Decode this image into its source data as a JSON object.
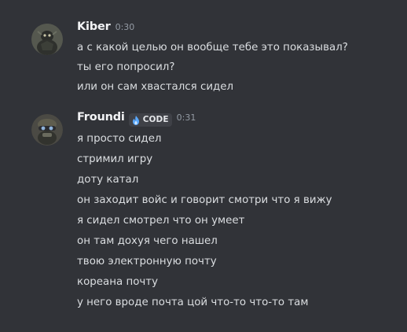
{
  "messages": [
    {
      "username": "Kiber",
      "timestamp": "0:30",
      "lines": [
        "а с какой целью он вообще тебе это показывал?",
        "ты его попросил?",
        "или он сам хвастался сидел"
      ]
    },
    {
      "username": "Froundi",
      "tag": {
        "icon": "flame-icon",
        "label": "CODE"
      },
      "timestamp": "0:31",
      "lines": [
        "я просто сидел",
        "стримил игру",
        "доту катал",
        "он заходит войс и говорит смотри что я вижу",
        "я сидел смотрел что он умеет",
        "он там дохуя чего нашел",
        "твою электронную почту",
        "кореана почту",
        "у него вроде почта цой что-то что-то там"
      ]
    }
  ],
  "colors": {
    "background": "#313338",
    "username": "#f2f3f5",
    "text": "#dbdee1",
    "timestamp": "#949ba4",
    "tag_background": "#3f4147",
    "tag_icon": "#5aa9ff"
  }
}
